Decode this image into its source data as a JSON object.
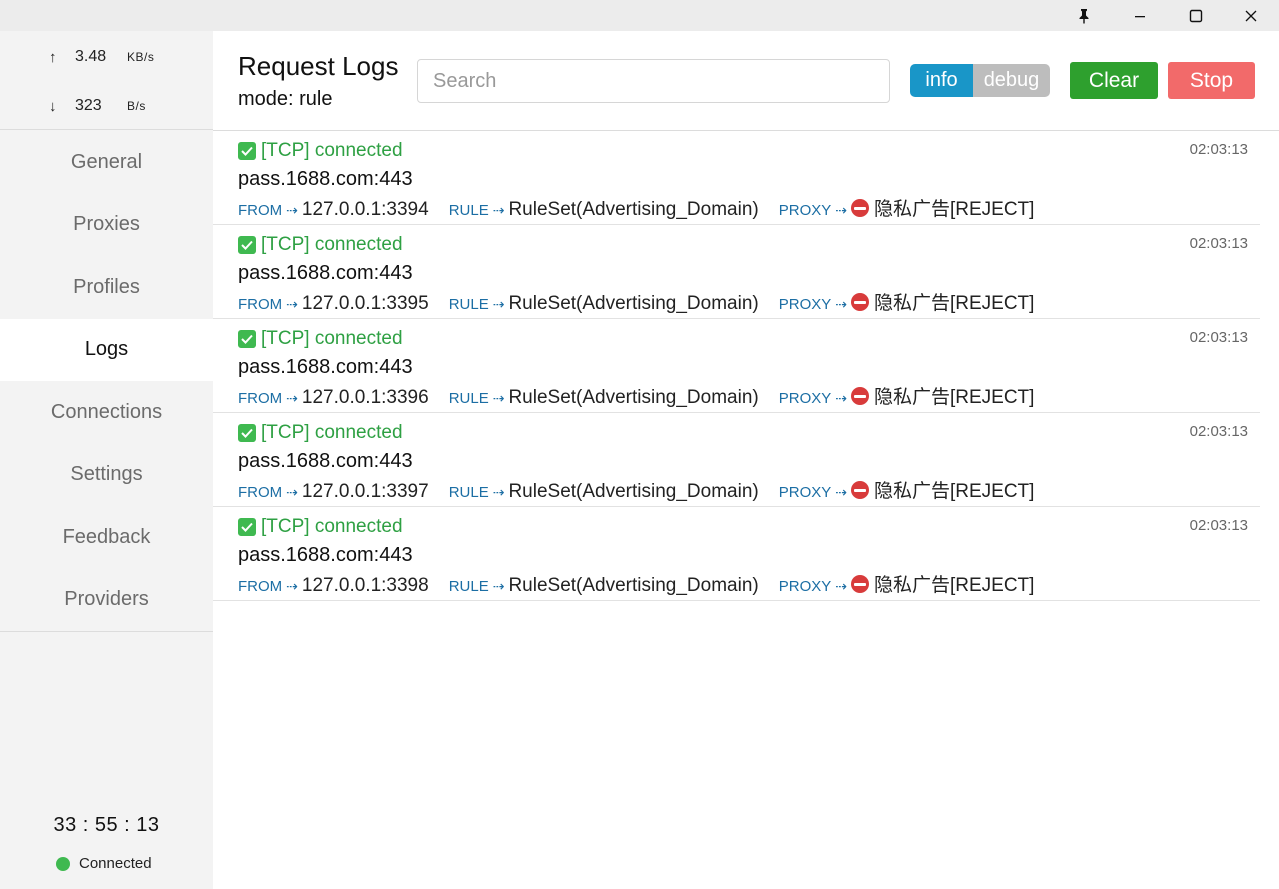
{
  "sidebar": {
    "upload": {
      "arrow": "↑",
      "value": "3.48",
      "unit": "KB/s"
    },
    "download": {
      "arrow": "↓",
      "value": "323",
      "unit": "B/s"
    },
    "items": [
      {
        "id": "general",
        "label": "General"
      },
      {
        "id": "proxies",
        "label": "Proxies"
      },
      {
        "id": "profiles",
        "label": "Profiles"
      },
      {
        "id": "logs",
        "label": "Logs",
        "active": true
      },
      {
        "id": "connections",
        "label": "Connections"
      },
      {
        "id": "settings",
        "label": "Settings"
      },
      {
        "id": "feedback",
        "label": "Feedback"
      },
      {
        "id": "providers",
        "label": "Providers"
      }
    ],
    "uptime": "33 : 55 : 13",
    "status": "Connected"
  },
  "header": {
    "title": "Request Logs",
    "mode": "mode: rule",
    "search_placeholder": "Search",
    "level_info": "info",
    "level_debug": "debug",
    "clear_label": "Clear",
    "stop_label": "Stop"
  },
  "labels": {
    "from": "FROM",
    "rule": "RULE",
    "proxy": "PROXY",
    "arrow": "⇢"
  },
  "logs": [
    {
      "status": "[TCP] connected",
      "time": "02:03:13",
      "host": "pass.1688.com:443",
      "from": "127.0.0.1:3394",
      "rule": "RuleSet(Advertising_Domain)",
      "proxy": "隐私广告[REJECT]"
    },
    {
      "status": "[TCP] connected",
      "time": "02:03:13",
      "host": "pass.1688.com:443",
      "from": "127.0.0.1:3395",
      "rule": "RuleSet(Advertising_Domain)",
      "proxy": "隐私广告[REJECT]"
    },
    {
      "status": "[TCP] connected",
      "time": "02:03:13",
      "host": "pass.1688.com:443",
      "from": "127.0.0.1:3396",
      "rule": "RuleSet(Advertising_Domain)",
      "proxy": "隐私广告[REJECT]"
    },
    {
      "status": "[TCP] connected",
      "time": "02:03:13",
      "host": "pass.1688.com:443",
      "from": "127.0.0.1:3397",
      "rule": "RuleSet(Advertising_Domain)",
      "proxy": "隐私广告[REJECT]"
    },
    {
      "status": "[TCP] connected",
      "time": "02:03:13",
      "host": "pass.1688.com:443",
      "from": "127.0.0.1:3398",
      "rule": "RuleSet(Advertising_Domain)",
      "proxy": "隐私广告[REJECT]"
    }
  ]
}
